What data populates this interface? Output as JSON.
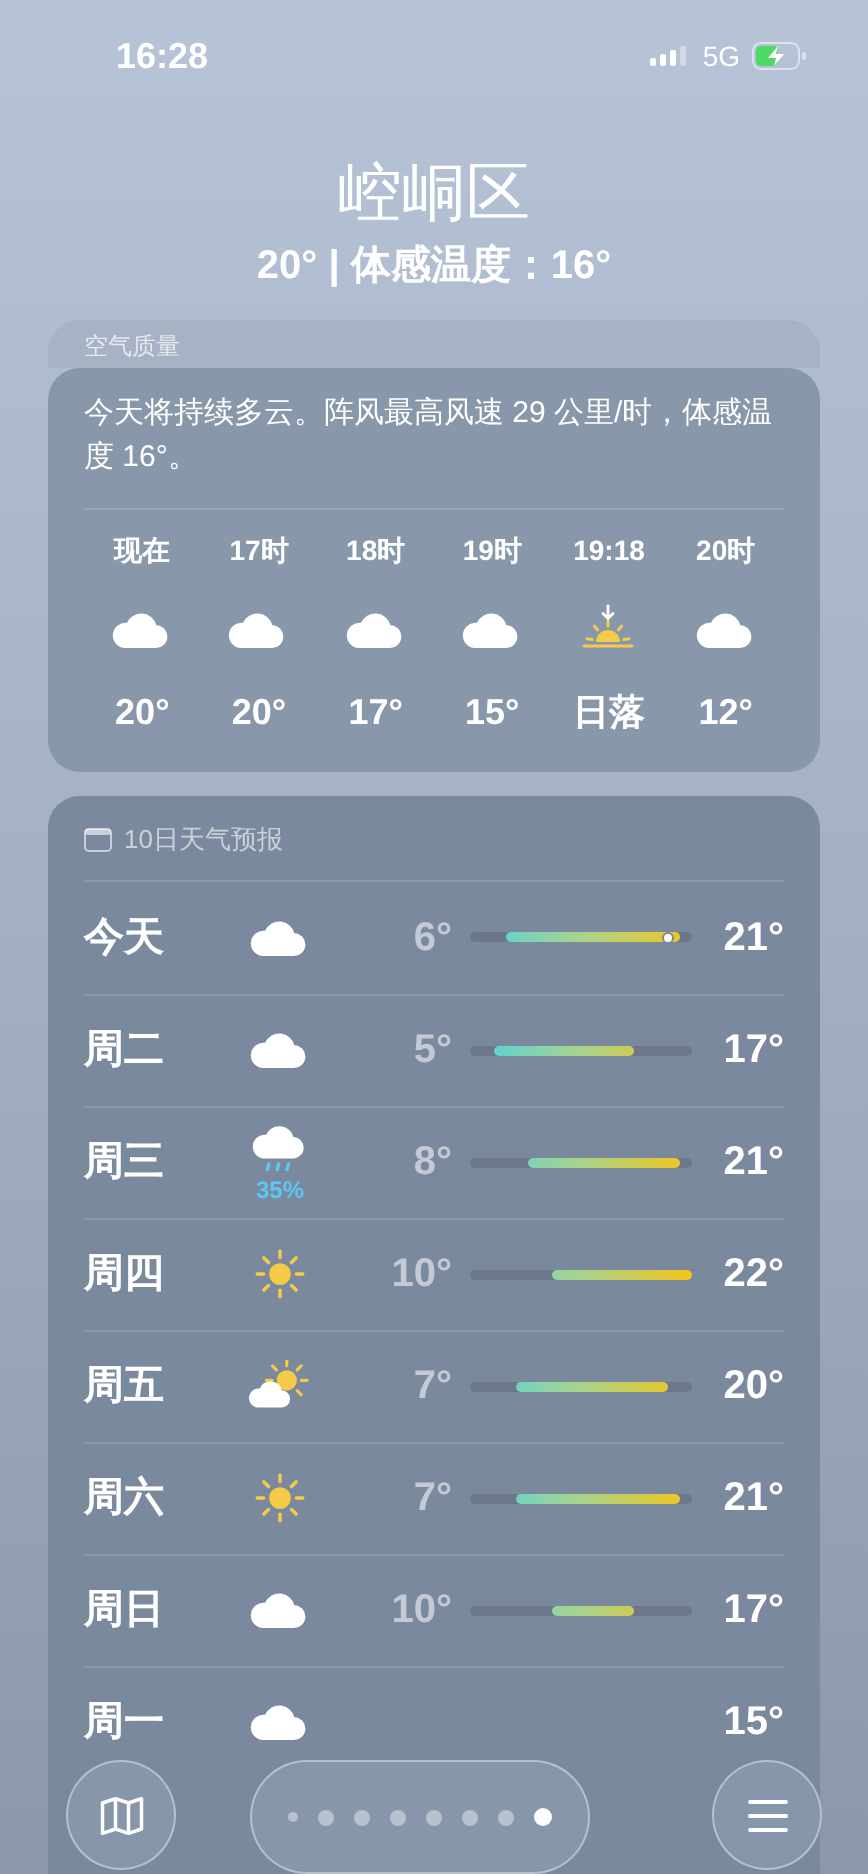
{
  "status_bar": {
    "time": "16:28",
    "network": "5G"
  },
  "location": {
    "name": "崆峒区",
    "summary": "20° | 体感温度：16°"
  },
  "air_quality": {
    "title": "空气质量"
  },
  "summary_card": {
    "text": "今天将持续多云。阵风最高风速 29 公里/时，体感温度 16°。",
    "hours": [
      {
        "time": "现在",
        "kind": "cloudy",
        "temp": "20°"
      },
      {
        "time": "17时",
        "kind": "cloudy",
        "temp": "20°"
      },
      {
        "time": "18时",
        "kind": "cloudy",
        "temp": "17°"
      },
      {
        "time": "19时",
        "kind": "cloudy",
        "temp": "15°"
      },
      {
        "time": "19:18",
        "kind": "sunset",
        "temp": "日落"
      },
      {
        "time": "20时",
        "kind": "cloudy",
        "temp": "12°"
      }
    ]
  },
  "forecast": {
    "title": "10日天气预报",
    "days": [
      {
        "day": "今天",
        "kind": "cloudy",
        "low": "6°",
        "high": "21°",
        "now_marker": {
          "level": 0.895
        }
      },
      {
        "day": "周二",
        "kind": "cloudy",
        "low": "5°",
        "high": "17°"
      },
      {
        "day": "周三",
        "kind": "rain",
        "precip": "35%",
        "low": "8°",
        "high": "21°"
      },
      {
        "day": "周四",
        "kind": "sunny",
        "low": "10°",
        "high": "22°"
      },
      {
        "day": "周五",
        "kind": "partly_sunny",
        "low": "7°",
        "high": "20°"
      },
      {
        "day": "周六",
        "kind": "sunny",
        "low": "7°",
        "high": "21°"
      },
      {
        "day": "周日",
        "kind": "cloudy",
        "low": "10°",
        "high": "17°"
      },
      {
        "day": "周一",
        "kind": "cloudy",
        "high": "15°"
      }
    ]
  },
  "bottom_bar": {
    "pages": [
      {
        "selected": false
      },
      {
        "selected": false
      },
      {
        "selected": false
      },
      {
        "selected": false
      },
      {
        "selected": false
      },
      {
        "selected": false
      },
      {
        "selected": false
      },
      {
        "selected": true
      }
    ]
  }
}
